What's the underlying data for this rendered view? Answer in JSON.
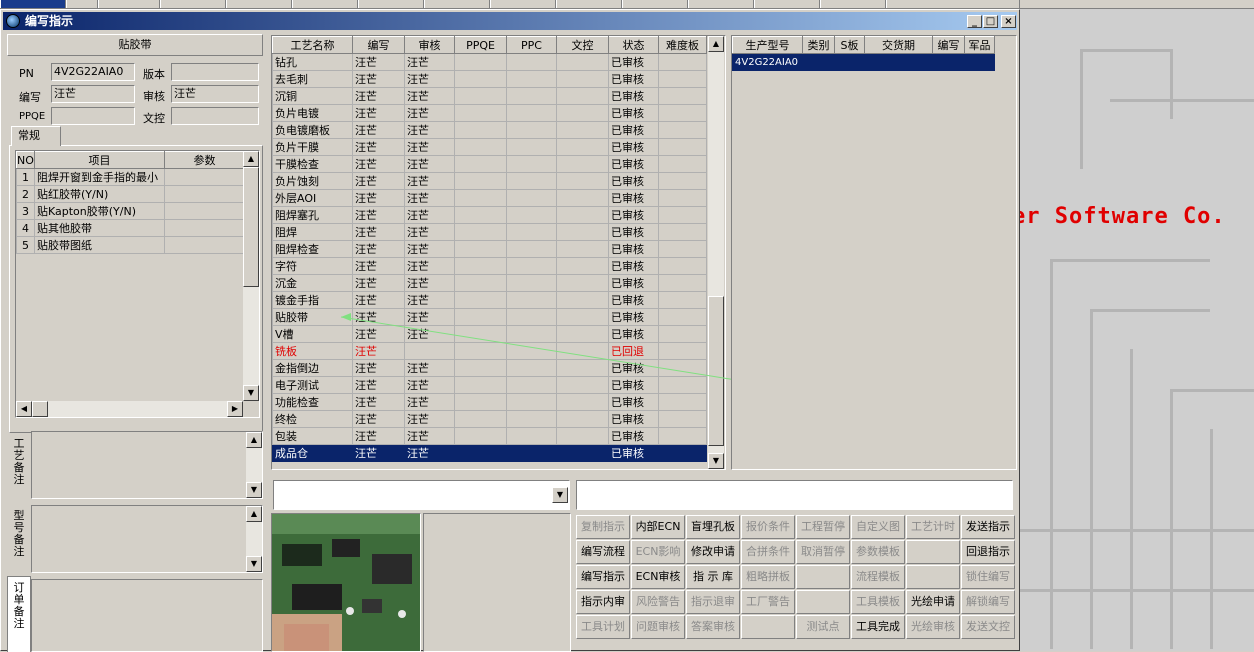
{
  "window": {
    "title": "编写指示"
  },
  "left": {
    "section_title": "贴胶带",
    "pn_label": "PN",
    "pn_value": "4V2G22AIA0",
    "version_label": "版本",
    "version_value": "",
    "author_label": "编写",
    "author_value": "汪芒",
    "reviewer_label": "审核",
    "reviewer_value": "汪芒",
    "ppqe_label": "PPQE",
    "ppqe_value": "",
    "doc_label": "文控",
    "doc_value": "",
    "tab_label": "常规",
    "params": {
      "headers": [
        "NO",
        "项目",
        "参数"
      ],
      "rows": [
        {
          "no": "1",
          "item": "阻焊开窗到金手指的最小",
          "param": ""
        },
        {
          "no": "2",
          "item": "贴红胶带(Y/N)",
          "param": ""
        },
        {
          "no": "3",
          "item": "贴Kapton胶带(Y/N)",
          "param": ""
        },
        {
          "no": "4",
          "item": "贴其他胶带",
          "param": ""
        },
        {
          "no": "5",
          "item": "贴胶带图纸",
          "param": ""
        }
      ]
    },
    "remarks": [
      {
        "label": "工艺备注"
      },
      {
        "label": "型号备注"
      },
      {
        "label": "订单备注"
      }
    ]
  },
  "process": {
    "headers": [
      "工艺名称",
      "编写",
      "审核",
      "PPQE",
      "PPC",
      "文控",
      "状态",
      "难度板"
    ],
    "rows": [
      {
        "name": "钻孔",
        "author": "汪芒",
        "reviewer": "汪芒",
        "status": "已审核",
        "state": "normal"
      },
      {
        "name": "去毛刺",
        "author": "汪芒",
        "reviewer": "汪芒",
        "status": "已审核",
        "state": "normal"
      },
      {
        "name": "沉铜",
        "author": "汪芒",
        "reviewer": "汪芒",
        "status": "已审核",
        "state": "normal"
      },
      {
        "name": "负片电镀",
        "author": "汪芒",
        "reviewer": "汪芒",
        "status": "已审核",
        "state": "normal"
      },
      {
        "name": "负电镀磨板",
        "author": "汪芒",
        "reviewer": "汪芒",
        "status": "已审核",
        "state": "normal"
      },
      {
        "name": "负片干膜",
        "author": "汪芒",
        "reviewer": "汪芒",
        "status": "已审核",
        "state": "normal"
      },
      {
        "name": "干膜检查",
        "author": "汪芒",
        "reviewer": "汪芒",
        "status": "已审核",
        "state": "normal"
      },
      {
        "name": "负片蚀刻",
        "author": "汪芒",
        "reviewer": "汪芒",
        "status": "已审核",
        "state": "normal"
      },
      {
        "name": "外层AOI",
        "author": "汪芒",
        "reviewer": "汪芒",
        "status": "已审核",
        "state": "normal"
      },
      {
        "name": "阻焊塞孔",
        "author": "汪芒",
        "reviewer": "汪芒",
        "status": "已审核",
        "state": "normal"
      },
      {
        "name": "阻焊",
        "author": "汪芒",
        "reviewer": "汪芒",
        "status": "已审核",
        "state": "normal"
      },
      {
        "name": "阻焊检查",
        "author": "汪芒",
        "reviewer": "汪芒",
        "status": "已审核",
        "state": "normal"
      },
      {
        "name": "字符",
        "author": "汪芒",
        "reviewer": "汪芒",
        "status": "已审核",
        "state": "normal"
      },
      {
        "name": "沉金",
        "author": "汪芒",
        "reviewer": "汪芒",
        "status": "已审核",
        "state": "normal"
      },
      {
        "name": "镀金手指",
        "author": "汪芒",
        "reviewer": "汪芒",
        "status": "已审核",
        "state": "normal"
      },
      {
        "name": "贴胶带",
        "author": "汪芒",
        "reviewer": "汪芒",
        "status": "已审核",
        "state": "normal"
      },
      {
        "name": "V槽",
        "author": "汪芒",
        "reviewer": "汪芒",
        "status": "已审核",
        "state": "normal"
      },
      {
        "name": "铣板",
        "author": "汪芒",
        "reviewer": "",
        "status": "已回退",
        "state": "red"
      },
      {
        "name": "金指倒边",
        "author": "汪芒",
        "reviewer": "汪芒",
        "status": "已审核",
        "state": "normal"
      },
      {
        "name": "电子测试",
        "author": "汪芒",
        "reviewer": "汪芒",
        "status": "已审核",
        "state": "normal"
      },
      {
        "name": "功能检查",
        "author": "汪芒",
        "reviewer": "汪芒",
        "status": "已审核",
        "state": "normal"
      },
      {
        "name": "终检",
        "author": "汪芒",
        "reviewer": "汪芒",
        "status": "已审核",
        "state": "normal"
      },
      {
        "name": "包装",
        "author": "汪芒",
        "reviewer": "汪芒",
        "status": "已审核",
        "state": "normal"
      },
      {
        "name": "成品仓",
        "author": "汪芒",
        "reviewer": "汪芒",
        "status": "已审核",
        "state": "selected"
      }
    ]
  },
  "models": {
    "headers": [
      "生产型号",
      "类别",
      "S板",
      "交货期",
      "编写",
      "军品"
    ],
    "rows": [
      {
        "model": "4V2G22AIA0",
        "category": "",
        "s": "",
        "due": "",
        "author": "",
        "mil": ""
      }
    ]
  },
  "combo_left_value": "",
  "combo_right_value": "",
  "desktop_text": "er Software Co.",
  "actions": [
    [
      "复制指示",
      "内部ECN",
      "盲埋孔板",
      "报价条件",
      "工程暂停",
      "自定义图",
      "工艺计时",
      "发送指示"
    ],
    [
      "编写流程",
      "ECN影响",
      "修改申请",
      "合拼条件",
      "取消暂停",
      "参数模板",
      "",
      "回退指示"
    ],
    [
      "编写指示",
      "ECN审核",
      "指 示 库",
      "粗略拼板",
      "",
      "流程模板",
      "",
      "锁住编写"
    ],
    [
      "指示内审",
      "风险警告",
      "指示退审",
      "工厂警告",
      "",
      "工具模板",
      "光绘申请",
      "解锁编写"
    ],
    [
      "工具计划",
      "问题审核",
      "答案审核",
      "",
      "测试点",
      "工具完成",
      "光绘审核",
      "发送文控"
    ]
  ],
  "actions_enabled": [
    [
      false,
      true,
      true,
      false,
      false,
      false,
      false,
      true
    ],
    [
      true,
      false,
      true,
      false,
      false,
      false,
      false,
      true
    ],
    [
      true,
      true,
      true,
      false,
      false,
      false,
      false,
      false
    ],
    [
      true,
      false,
      false,
      false,
      false,
      false,
      true,
      false
    ],
    [
      false,
      false,
      false,
      false,
      false,
      true,
      false,
      false
    ]
  ]
}
